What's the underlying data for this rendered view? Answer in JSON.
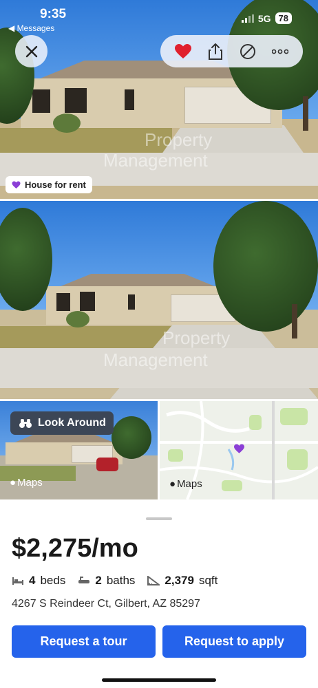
{
  "status_bar": {
    "time": "9:35",
    "back_app": "◀ Messages",
    "network": "5G",
    "battery": "78"
  },
  "listing": {
    "badge": "House for rent",
    "price": "$2,275/mo",
    "beds_count": "4",
    "beds_label": "beds",
    "baths_count": "2",
    "baths_label": "baths",
    "sqft_count": "2,379",
    "sqft_label": "sqft",
    "address": "4267 S Reindeer Ct, Gilbert, AZ 85297"
  },
  "watermark": {
    "line1": "Property",
    "line2": "Management",
    "photo2_line1": "Property",
    "photo2_line2": "Management"
  },
  "tiles": {
    "look_around": "Look Around",
    "maps_left": "Maps",
    "maps_right": "Maps"
  },
  "actions": {
    "tour": "Request a tour",
    "apply": "Request to apply"
  },
  "colors": {
    "primary": "#2563eb",
    "favorite": "#e0202e",
    "badge_heart": "#8b3fd6",
    "map_pin": "#8b3fd6"
  }
}
